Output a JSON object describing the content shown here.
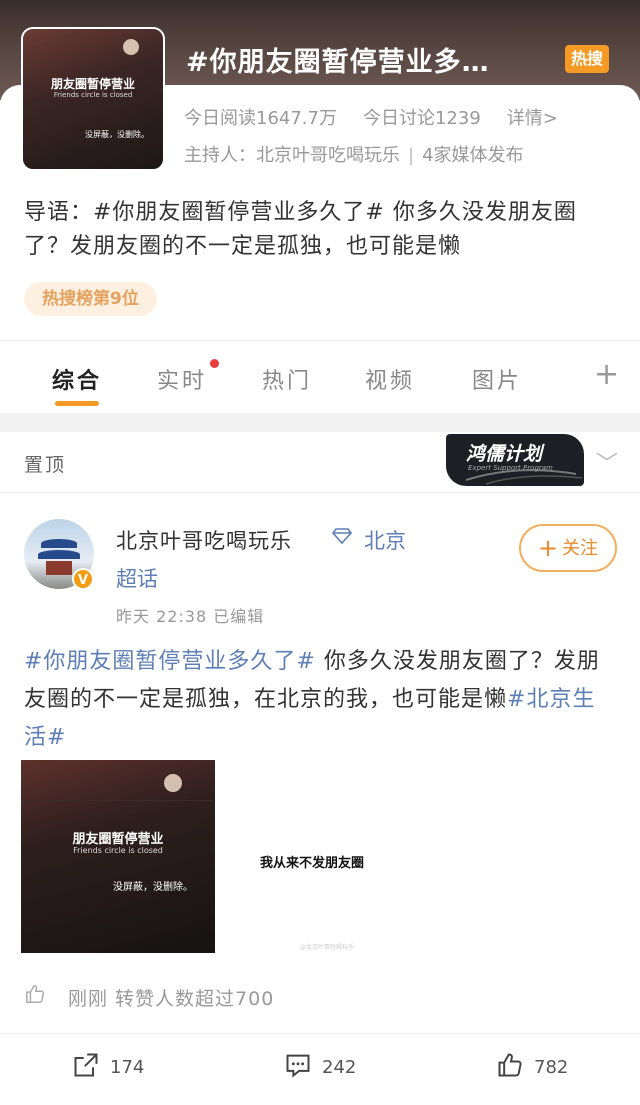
{
  "header": {
    "topic_title": "#你朋友圈暂停营业多…",
    "hot_badge": "热搜",
    "thumb_title": "朋友圈暂停营业",
    "thumb_subtitle": "Friends circle is closed",
    "thumb_note": "没屏蔽，没删除。",
    "stats": {
      "reads": "今日阅读1647.7万",
      "discussions": "今日讨论1239",
      "details": "详情>"
    },
    "host": {
      "host_label": "主持人：北京叶哥吃喝玩乐",
      "media": "4家媒体发布"
    },
    "intro": "导语：#你朋友圈暂停营业多久了# 你多久没发朋友圈了？发朋友圈的不一定是孤独，也可能是懒",
    "rank": "热搜榜第9位"
  },
  "tabs": {
    "items": [
      "综合",
      "实时",
      "热门",
      "视频",
      "图片"
    ],
    "plus": "+"
  },
  "pinned": {
    "label": "置顶",
    "promo_title": "鸿儒计划",
    "promo_subtitle": "Expert Support Program",
    "chevron": "﹀"
  },
  "post": {
    "author": "北京叶哥吃喝玩乐",
    "location_1": "北京",
    "location_2": "超话",
    "verified": "V",
    "follow_label": "关注",
    "meta": "昨天  22:38   已编辑",
    "text": {
      "hashtag1": "#你朋友圈暂停营业多久了#",
      "part1": " 你多久没发朋友圈了？发朋友圈的不一定是孤独，在北京的我，也可能是懒",
      "hashtag2": "#北京生活#"
    },
    "image1": {
      "title": "朋友圈暂停营业",
      "subtitle": "Friends circle is closed",
      "note": "没屏蔽，没删除。"
    },
    "image2": {
      "text": "我从来不发朋友圈",
      "watermark": "@北京叶哥吃喝玩乐"
    },
    "repost_line": "刚刚  转赞人数超过700",
    "actions": {
      "share_count": "174",
      "comment_count": "242",
      "like_count": "782"
    }
  },
  "colors": {
    "accent": "#f59a25",
    "link": "#5d7fb5",
    "red_dot": "#e83d3d"
  }
}
